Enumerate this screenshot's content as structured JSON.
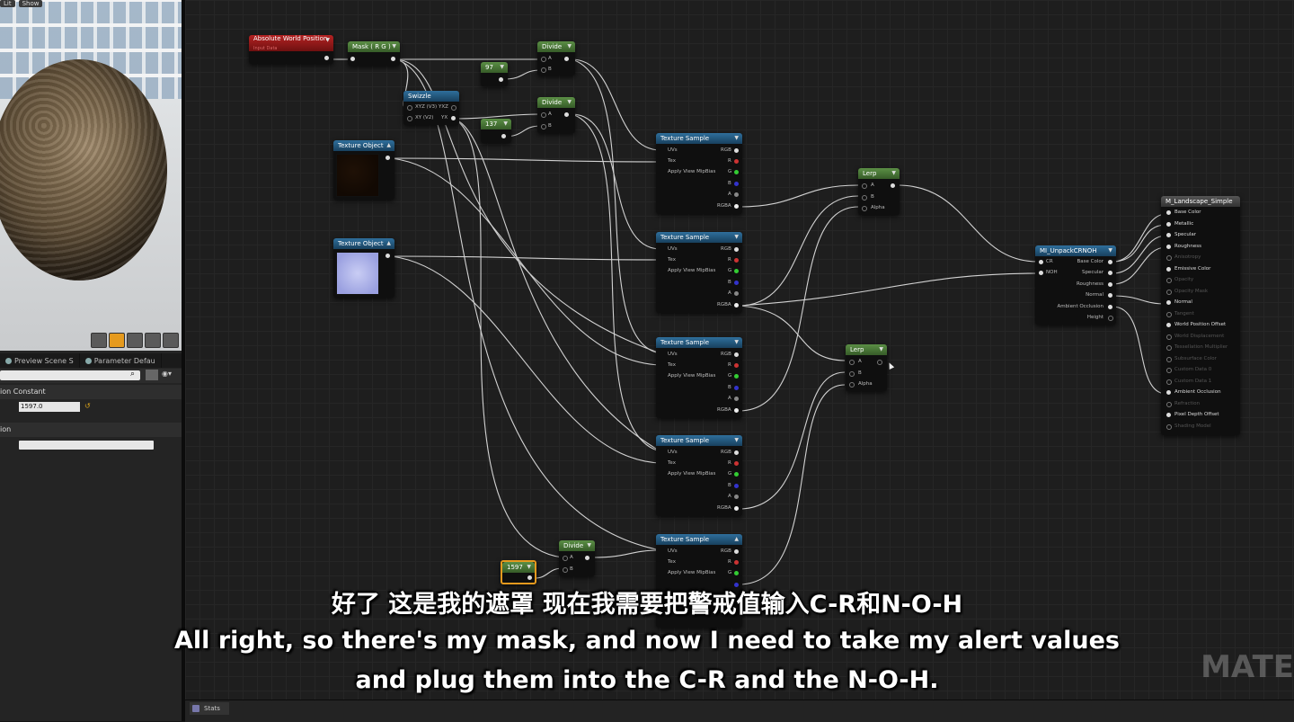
{
  "viewport": {
    "chip_lit": "Lit",
    "chip_show": "Show"
  },
  "panel": {
    "tabs": [
      {
        "label": "Preview Scene S"
      },
      {
        "label": "Parameter Defau"
      }
    ],
    "category_constant": "ion Constant",
    "constant_value": "1597.0",
    "category_desc": "ion"
  },
  "nodes": {
    "absolute_world_position": {
      "title": "Absolute World Position",
      "subtitle": "Input Data"
    },
    "mask": {
      "title": "Mask ( R G )"
    },
    "swizzle": {
      "title": "Swizzle",
      "pin1": "XYZ (V3)",
      "pin1_out": "YXZ",
      "pin2": "XY (V2)",
      "pin2_out": "YX"
    },
    "divide1": {
      "title": "Divide",
      "a": "A",
      "b": "B"
    },
    "divide2": {
      "title": "Divide",
      "a": "A",
      "b": "B"
    },
    "divide3": {
      "title": "Divide",
      "a": "A",
      "b": "B"
    },
    "const97": {
      "title": "97"
    },
    "const137": {
      "title": "137"
    },
    "const1597": {
      "title": "1597"
    },
    "tex_obj1": {
      "title": "Texture Object"
    },
    "tex_obj2": {
      "title": "Texture Object"
    },
    "texture_sample": {
      "title": "Texture Sample",
      "uvs": "UVs",
      "tex": "Tex",
      "mip": "Apply View MipBias",
      "rgb": "RGB",
      "r": "R",
      "g": "G",
      "b": "B",
      "a": "A",
      "rgba": "RGBA"
    },
    "lerp1": {
      "title": "Lerp",
      "a": "A",
      "b": "B",
      "alpha": "Alpha"
    },
    "lerp2": {
      "title": "Lerp",
      "a": "A",
      "b": "B",
      "alpha": "Alpha"
    },
    "unpack": {
      "title": "MI_UnpackCRNOH",
      "in_cr": "CR",
      "in_noh": "NOH",
      "outs": [
        "Base Color",
        "Specular",
        "Roughness",
        "Normal",
        "Ambient Occlusion",
        "Height"
      ]
    },
    "material": {
      "title": "M_Landscape_Simple",
      "pins": [
        {
          "label": "Base Color",
          "active": true
        },
        {
          "label": "Metallic",
          "active": true
        },
        {
          "label": "Specular",
          "active": true
        },
        {
          "label": "Roughness",
          "active": true
        },
        {
          "label": "Anisotropy",
          "active": false
        },
        {
          "label": "Emissive Color",
          "active": true
        },
        {
          "label": "Opacity",
          "active": false
        },
        {
          "label": "Opacity Mask",
          "active": false
        },
        {
          "label": "Normal",
          "active": true
        },
        {
          "label": "Tangent",
          "active": false
        },
        {
          "label": "World Position Offset",
          "active": true
        },
        {
          "label": "World Displacement",
          "active": false
        },
        {
          "label": "Tessellation Multiplier",
          "active": false
        },
        {
          "label": "Subsurface Color",
          "active": false
        },
        {
          "label": "Custom Data 0",
          "active": false
        },
        {
          "label": "Custom Data 1",
          "active": false
        },
        {
          "label": "Ambient Occlusion",
          "active": true
        },
        {
          "label": "Refraction",
          "active": false
        },
        {
          "label": "Pixel Depth Offset",
          "active": true
        },
        {
          "label": "Shading Model",
          "active": false
        }
      ]
    }
  },
  "statusbar": {
    "stats_label": "Stats"
  },
  "subtitles": {
    "chinese": "好了 这是我的遮罩 现在我需要把警戒值输入C-R和N-O-H",
    "english_line1": "All right, so there's my mask, and now I need to take my alert values",
    "english_line2": "and plug them into the C-R and the N-O-H."
  },
  "watermark": "MATE",
  "colors": {
    "accent_orange": "#e59a1e",
    "node_blue": "#2f6f9c",
    "node_green": "#5b8f45",
    "node_red": "#b52323"
  }
}
